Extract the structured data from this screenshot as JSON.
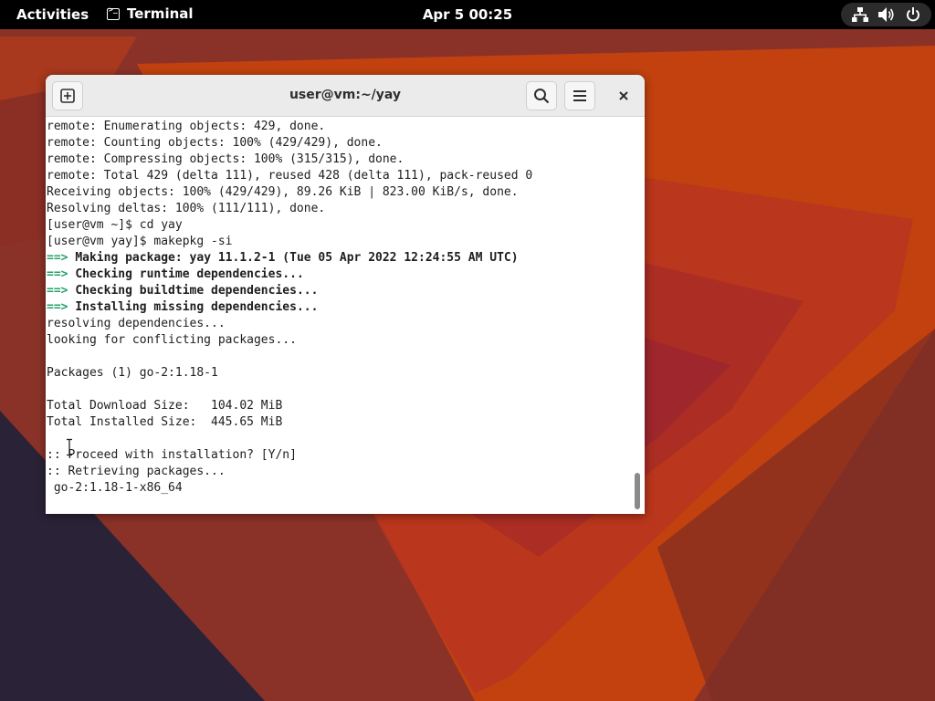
{
  "topbar": {
    "activities": "Activities",
    "app_name": "Terminal",
    "clock": "Apr 5  00:25",
    "status_icons": [
      "network-icon",
      "volume-icon",
      "power-icon"
    ]
  },
  "window": {
    "title": "user@vm:~/yay",
    "new_tab_icon": "new-tab-icon",
    "search_icon": "search-icon",
    "menu_icon": "hamburger-menu-icon",
    "close_icon": "close-icon"
  },
  "terminal": {
    "lines": [
      {
        "text": "remote: Enumerating objects: 429, done."
      },
      {
        "text": "remote: Counting objects: 100% (429/429), done."
      },
      {
        "text": "remote: Compressing objects: 100% (315/315), done."
      },
      {
        "text": "remote: Total 429 (delta 111), reused 428 (delta 111), pack-reused 0"
      },
      {
        "text": "Receiving objects: 100% (429/429), 89.26 KiB | 823.00 KiB/s, done."
      },
      {
        "text": "Resolving deltas: 100% (111/111), done."
      },
      {
        "text": "[user@vm ~]$ cd yay"
      },
      {
        "text": "[user@vm yay]$ makepkg -si"
      },
      {
        "prefix": "==> ",
        "text": "Making package: yay 11.1.2-1 (Tue 05 Apr 2022 12:24:55 AM UTC)"
      },
      {
        "prefix": "==> ",
        "text": "Checking runtime dependencies..."
      },
      {
        "prefix": "==> ",
        "text": "Checking buildtime dependencies..."
      },
      {
        "prefix": "==> ",
        "text": "Installing missing dependencies..."
      },
      {
        "text": "resolving dependencies..."
      },
      {
        "text": "looking for conflicting packages..."
      },
      {
        "text": ""
      },
      {
        "text": "Packages (1) go-2:1.18-1"
      },
      {
        "text": ""
      },
      {
        "text": "Total Download Size:   104.02 MiB"
      },
      {
        "text": "Total Installed Size:  445.65 MiB"
      },
      {
        "text": ""
      },
      {
        "text": ":: Proceed with installation? [Y/n]"
      },
      {
        "text": ":: Retrieving packages..."
      },
      {
        "text": " go-2:1.18-1-x86_64"
      }
    ]
  },
  "colors": {
    "prompt_arrow": "#26a269",
    "topbar_bg": "#000000",
    "headerbar_bg": "#ebebeb"
  }
}
